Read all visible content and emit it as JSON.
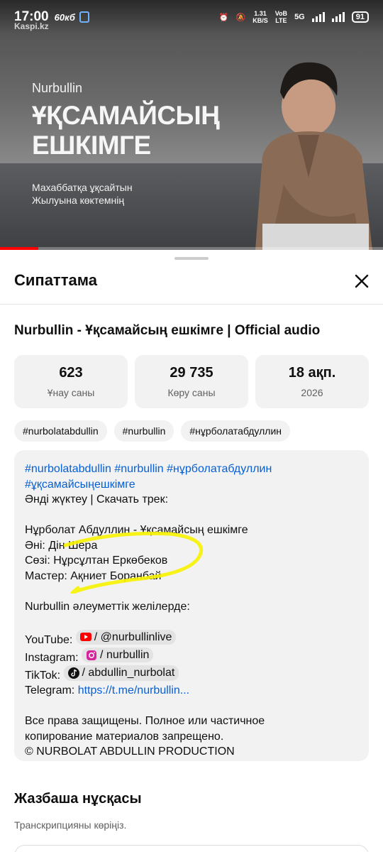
{
  "status_bar": {
    "time": "17:00",
    "speed": "60кб",
    "watermark": "Kaspi.kz",
    "net_speed": "1.31",
    "net_unit": "KB/S",
    "net_type_1": "VoB",
    "net_type_2": "LTE",
    "gen": "5G",
    "battery": "91"
  },
  "video": {
    "artist": "Nurbullin",
    "title_line1": "ҰҚСАМАЙСЫҢ",
    "title_line2": "ЕШКІМГЕ",
    "lyric_line1": "Махаббатқа ұқсайтын",
    "lyric_line2": "Жылуына көктемнің",
    "progress": 0.1
  },
  "sheet": {
    "header": "Сипаттама",
    "video_title": "Nurbullin - Ұқсамайсың ешкімге | Official audio",
    "stats": [
      {
        "value": "623",
        "label": "Ұнау саны"
      },
      {
        "value": "29 735",
        "label": "Көру саны"
      },
      {
        "value": "18 ақп.",
        "label": "2026"
      }
    ],
    "tags": [
      "#nurbolatabdullin",
      "#nurbullin",
      "#нұрболатабдуллин"
    ],
    "description": {
      "hashtags_line1": "#nurbolatabdullin #nurbullin #нұрболатабдуллин",
      "hashtags_line2": "#ұқсамайсыңешкімге",
      "download": "Әнді жүктеу | Скачать трек:",
      "song": "Нұрболат Абдуллин - Ұқсамайсың ешкімге",
      "music": "Әні: Дін Шера",
      "lyrics": "Сөзі: Нұрсұлтан Еркөбеков",
      "master": "Мастер: Ақниет Боранбай",
      "social_intro": "Nurbullin әлеуметтік желілерде:",
      "youtube_label": "YouTube:",
      "youtube_handle": "/ @nurbullinlive",
      "instagram_label": "Instagram:",
      "instagram_handle": "/ nurbullin",
      "tiktok_label": "TikTok:",
      "tiktok_handle": "/ abdullin_nurbolat",
      "telegram_label": "Telegram:",
      "telegram_link": "https://t.me/nurbullin...",
      "rights_1": "Все права защищены. Полное или частичное",
      "rights_2": "копирование материалов запрещено.",
      "rights_3": "© NURBOLAT ABDULLIN PRODUCTION"
    },
    "transcript_title": "Жазбаша нұсқасы",
    "transcript_sub": "Транскрипцияны көріңіз."
  },
  "colors": {
    "link": "#065fd4",
    "highlight": "#f7f200",
    "progress": "#ff0000"
  }
}
